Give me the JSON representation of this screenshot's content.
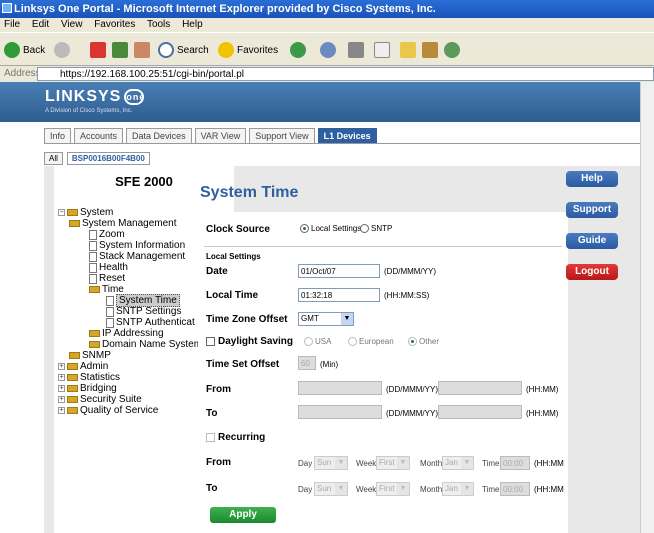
{
  "window": {
    "title": "Linksys One Portal - Microsoft Internet Explorer provided by Cisco Systems, Inc."
  },
  "menu": [
    "File",
    "Edit",
    "View",
    "Favorites",
    "Tools",
    "Help"
  ],
  "toolbar": {
    "back": "Back",
    "search": "Search",
    "favorites": "Favorites"
  },
  "address": {
    "label": "Address",
    "url": "https://192.168.100.25:51/cgi-bin/portal.pl"
  },
  "brand": {
    "logo": "LINKSYS",
    "one": "one",
    "tagline": "A Division of Cisco Systems, Inc."
  },
  "tabs": [
    "Info",
    "Accounts",
    "Data Devices",
    "VAR View",
    "Support View",
    "L1 Devices"
  ],
  "device_tabs": [
    "All",
    "BSP0016B00F4B00"
  ],
  "nav": {
    "product": "SFE 2000",
    "tree": [
      "System",
      "System Management",
      "Zoom",
      "System Information",
      "Stack Management",
      "Health",
      "Reset",
      "Time",
      "System Time",
      "SNTP Settings",
      "SNTP Authenticat",
      "IP Addressing",
      "Domain Name System",
      "SNMP",
      "Admin",
      "Statistics",
      "Bridging",
      "Security Suite",
      "Quality of Service"
    ]
  },
  "page": {
    "title": "System Time",
    "clock_source_label": "Clock Source",
    "clock_local": "Local Settings",
    "clock_sntp": "SNTP",
    "local_settings_heading": "Local Settings",
    "date_label": "Date",
    "date_value": "01/Oct/07",
    "date_format": "(DD/MMM/YY)",
    "local_time_label": "Local Time",
    "local_time_value": "01:32:18",
    "time_format": "(HH:MM:SS)",
    "tz_offset_label": "Time Zone Offset",
    "tz_offset_value": "GMT",
    "daylight_label": "Daylight Saving",
    "dst_usa": "USA",
    "dst_european": "European",
    "dst_other": "Other",
    "time_set_offset_label": "Time Set Offset",
    "time_set_offset_value": "60",
    "min_unit": "(Min)",
    "from_label": "From",
    "to_label": "To",
    "ddmmmyy": "(DD/MMM/YY)",
    "hhmm": "(HH:MM)",
    "recurring_label": "Recurring",
    "day_label": "Day",
    "day_value": "Sun",
    "week_label": "Week",
    "week_value": "First",
    "month_label": "Month",
    "month_value": "Jan",
    "time_label": "Time",
    "time_value": "00:00",
    "hhmm_trunc": "(HH:MM",
    "apply": "Apply"
  },
  "actions": [
    "Help",
    "Support",
    "Guide",
    "Logout"
  ]
}
